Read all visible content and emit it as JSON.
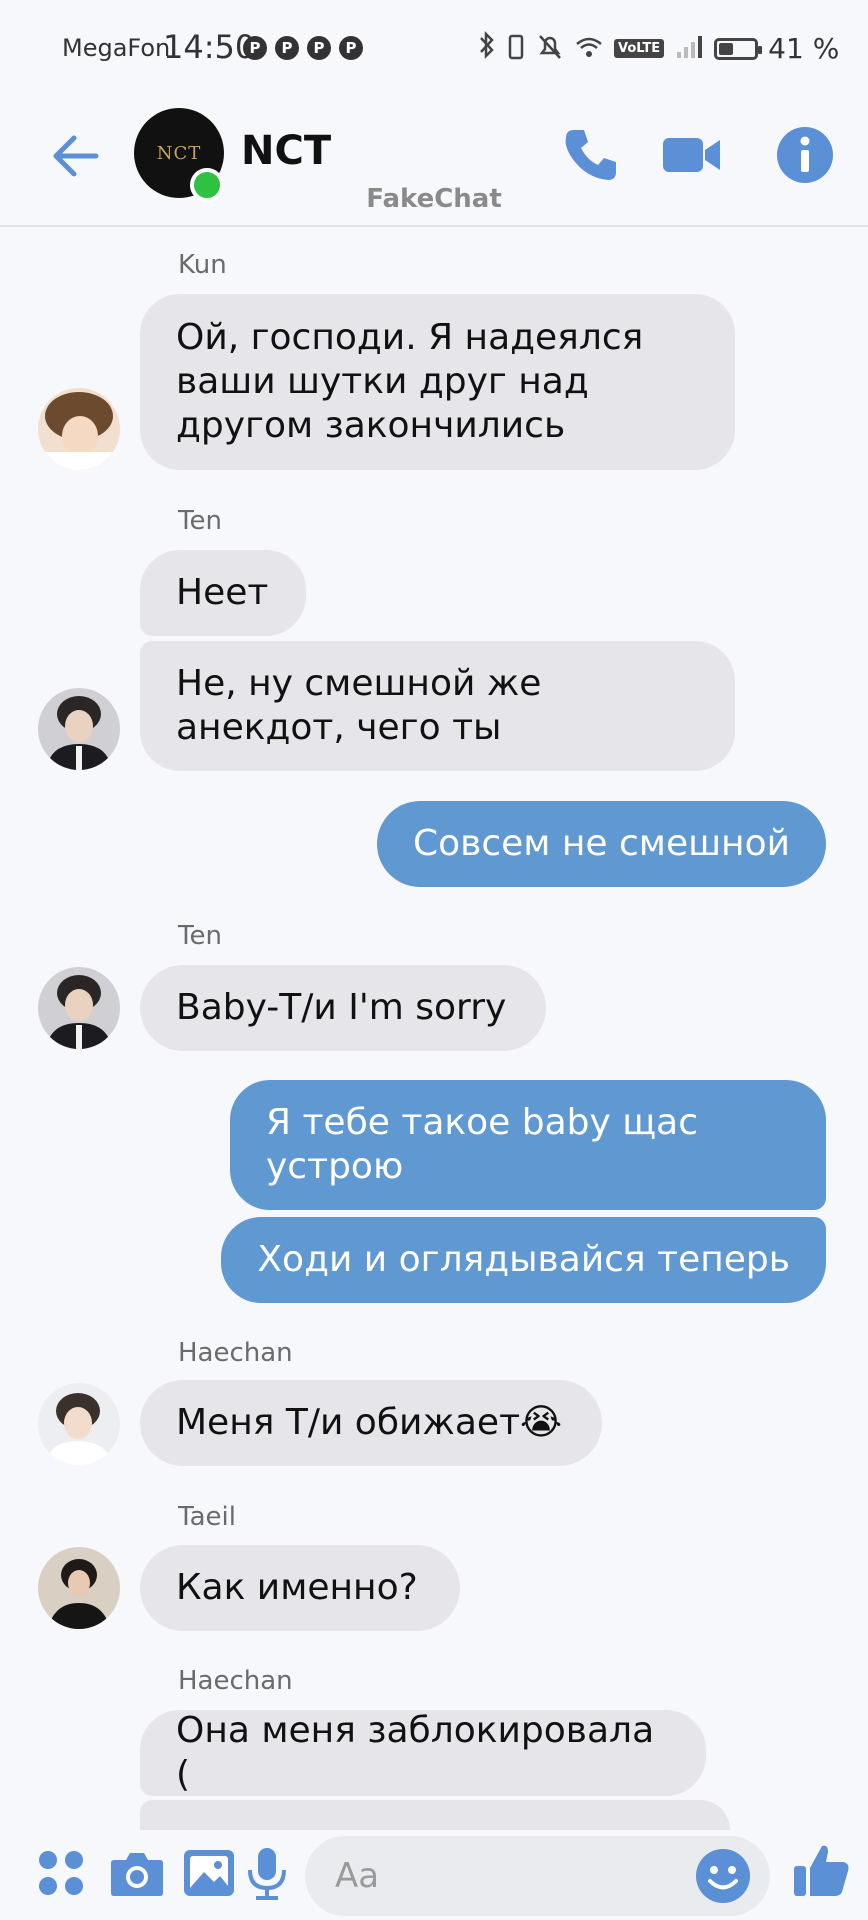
{
  "status_bar": {
    "carrier": "MegaFon",
    "time": "14:50",
    "notification_icons": [
      "P",
      "P",
      "P",
      "P"
    ],
    "volte": "VoLTE",
    "battery_level": 0.41,
    "battery_text": "41 %"
  },
  "header": {
    "title": "NCT",
    "avatar_text": "NCT",
    "watermark": "FakeChat",
    "online": true
  },
  "messages": [
    {
      "sender": "Kun",
      "text": "Ой, господи. Я надеялся\nваши шутки друг над\nдругом закончились"
    },
    {
      "sender": "Ten",
      "text": "Неет"
    },
    {
      "text": "Не, ну смешной же\nанекдот, чего ты"
    },
    {
      "text": "Совсем не смешной"
    },
    {
      "sender": "Ten",
      "text": "Baby-Т/и I'm sorry"
    },
    {
      "text": "Я тебе такое baby щас\nустрою"
    },
    {
      "text": "Ходи и оглядывайся теперь"
    },
    {
      "sender": "Haechan",
      "text": "Меня Т/и обижает😭"
    },
    {
      "sender": "Taeil",
      "text": "Как именно?"
    },
    {
      "sender": "Haechan",
      "text": "Она меня заблокировала ("
    }
  ],
  "composer": {
    "placeholder": "Aa"
  },
  "colors": {
    "outgoing_bubble": "#6098d2",
    "incoming_bubble": "#e6e6ea",
    "accent": "#5b8fd6",
    "online": "#2ec242"
  },
  "icons": [
    "back-arrow-icon",
    "phone-icon",
    "video-camera-icon",
    "info-icon",
    "apps-icon",
    "camera-icon",
    "image-icon",
    "microphone-icon",
    "emoji-icon",
    "thumbs-up-icon"
  ]
}
